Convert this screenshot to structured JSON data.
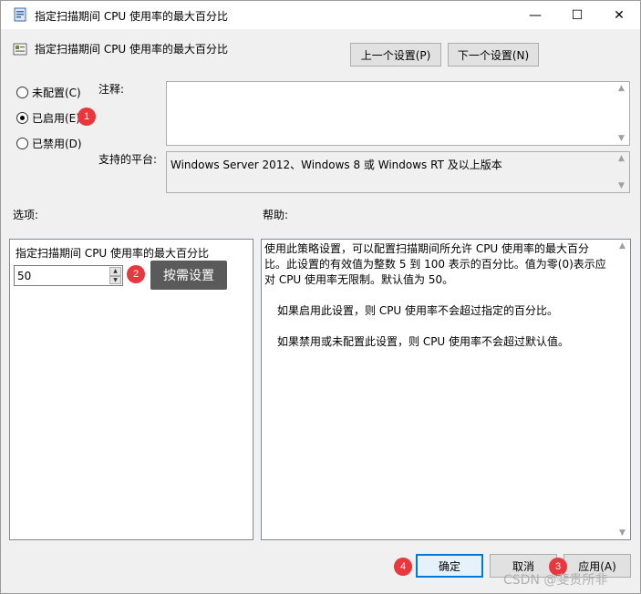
{
  "window": {
    "title": "指定扫描期间 CPU 使用率的最大百分比",
    "header": "指定扫描期间 CPU 使用率的最大百分比",
    "minimize_glyph": "—",
    "maximize_glyph": "☐",
    "close_glyph": "✕"
  },
  "nav": {
    "prev_label": "上一个设置(P)",
    "next_label": "下一个设置(N)"
  },
  "state": {
    "options": [
      {
        "label": "未配置(C)",
        "checked": false
      },
      {
        "label": "已启用(E)",
        "checked": true
      },
      {
        "label": "已禁用(D)",
        "checked": false
      }
    ]
  },
  "comment": {
    "label": "注释:",
    "value": ""
  },
  "platform": {
    "label": "支持的平台:",
    "value": "Windows Server 2012、Windows 8 或 Windows RT 及以上版本"
  },
  "options_section": {
    "label": "选项:",
    "field_label": "指定扫描期间 CPU 使用率的最大百分比",
    "field_value": "50"
  },
  "help_section": {
    "label": "帮助:",
    "paragraphs": [
      "使用此策略设置，可以配置扫描期间所允许 CPU 使用率的最大百分比。此设置的有效值为整数 5 到 100 表示的百分比。值为零(0)表示应对 CPU 使用率无限制。默认值为 50。",
      "如果启用此设置，则 CPU 使用率不会超过指定的百分比。",
      "如果禁用或未配置此设置，则 CPU 使用率不会超过默认值。"
    ]
  },
  "footer": {
    "ok_label": "确定",
    "cancel_label": "取消",
    "apply_label": "应用(A)"
  },
  "annotations": {
    "badge1": "1",
    "badge2": "2",
    "badge3": "3",
    "badge4": "4",
    "tooltip": "按需设置"
  },
  "watermark": "CSDN @斐贵所非",
  "colors": {
    "badge": "#e8383d",
    "accent": "#0078d7"
  }
}
